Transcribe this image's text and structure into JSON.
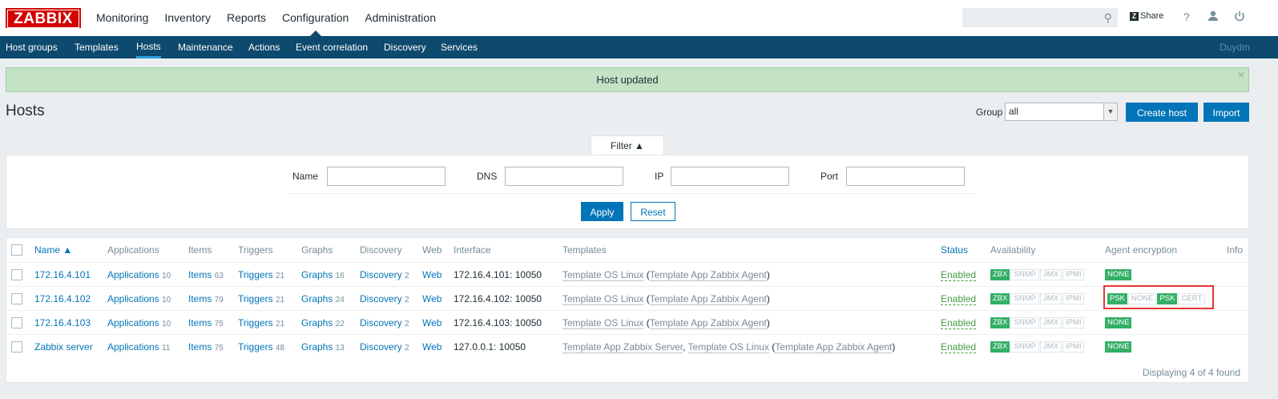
{
  "logo": "ZABBIX",
  "main_nav": [
    "Monitoring",
    "Inventory",
    "Reports",
    "Configuration",
    "Administration"
  ],
  "header": {
    "share": "Share",
    "help": "?"
  },
  "sub_nav": [
    "Host groups",
    "Templates",
    "Hosts",
    "Maintenance",
    "Actions",
    "Event correlation",
    "Discovery",
    "Services"
  ],
  "user": "Duydm",
  "message": "Host updated",
  "page": {
    "title": "Hosts",
    "group_label": "Group",
    "group_value": "all",
    "create_label": "Create host",
    "import_label": "Import"
  },
  "filter": {
    "tab": "Filter ▲",
    "name": "Name",
    "dns": "DNS",
    "ip": "IP",
    "port": "Port",
    "apply": "Apply",
    "reset": "Reset"
  },
  "table": {
    "headers": [
      "Name ▲",
      "Applications",
      "Items",
      "Triggers",
      "Graphs",
      "Discovery",
      "Web",
      "Interface",
      "Templates",
      "Status",
      "Availability",
      "Agent encryption",
      "Info"
    ],
    "rows": [
      {
        "name": "172.16.4.101",
        "apps": "Applications",
        "apps_n": "10",
        "items": "Items",
        "items_n": "63",
        "triggers": "Triggers",
        "triggers_n": "21",
        "graphs": "Graphs",
        "graphs_n": "16",
        "disc": "Discovery",
        "disc_n": "2",
        "web": "Web",
        "iface": "172.16.4.101: 10050",
        "t1": "Template OS Linux",
        "t2": "",
        "tp": "Template App Zabbix Agent",
        "status": "Enabled"
      },
      {
        "name": "172.16.4.102",
        "apps": "Applications",
        "apps_n": "10",
        "items": "Items",
        "items_n": "79",
        "triggers": "Triggers",
        "triggers_n": "21",
        "graphs": "Graphs",
        "graphs_n": "24",
        "disc": "Discovery",
        "disc_n": "2",
        "web": "Web",
        "iface": "172.16.4.102: 10050",
        "t1": "Template OS Linux",
        "t2": "",
        "tp": "Template App Zabbix Agent",
        "status": "Enabled"
      },
      {
        "name": "172.16.4.103",
        "apps": "Applications",
        "apps_n": "10",
        "items": "Items",
        "items_n": "75",
        "triggers": "Triggers",
        "triggers_n": "21",
        "graphs": "Graphs",
        "graphs_n": "22",
        "disc": "Discovery",
        "disc_n": "2",
        "web": "Web",
        "iface": "172.16.4.103: 10050",
        "t1": "Template OS Linux",
        "t2": "",
        "tp": "Template App Zabbix Agent",
        "status": "Enabled"
      },
      {
        "name": "Zabbix server",
        "apps": "Applications",
        "apps_n": "11",
        "items": "Items",
        "items_n": "75",
        "triggers": "Triggers",
        "triggers_n": "48",
        "graphs": "Graphs",
        "graphs_n": "13",
        "disc": "Discovery",
        "disc_n": "2",
        "web": "Web",
        "iface": "127.0.0.1: 10050",
        "t1": "Template App Zabbix Server",
        "t2": "Template OS Linux",
        "tp": "Template App Zabbix Agent",
        "status": "Enabled"
      }
    ],
    "avail": [
      "ZBX",
      "SNMP",
      "JMX",
      "IPMI"
    ],
    "enc_none": "NONE",
    "enc_detail": [
      "PSK",
      "NONE",
      "PSK",
      "CERT"
    ],
    "footer": "Displaying 4 of 4 found"
  },
  "colors": {
    "brand": "#d40000",
    "nav": "#0e4a6e",
    "accent": "#0275b8",
    "ok": "#34af67",
    "highlight": "#e33734"
  }
}
